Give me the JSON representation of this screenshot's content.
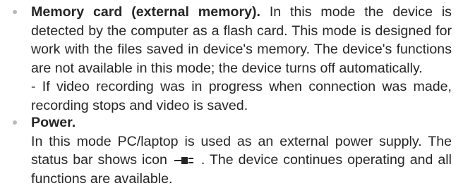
{
  "items": [
    {
      "title": "Memory card (external memory).",
      "text": "In this mode the device is detected by the computer as a flash card. This mode is designed for work with the files saved in device's memory. The device's functions are not available in this mode; the device turns off automatically.",
      "note": "- If video recording was in progress when connection was made, recording stops and video is saved."
    },
    {
      "title": "Power.",
      "text_before_icon": "In this mode PC/laptop is used as an external power supply. The status bar shows icon",
      "icon": "power-plug-icon",
      "text_after_icon": ". The device continues operating and all functions are available."
    }
  ]
}
